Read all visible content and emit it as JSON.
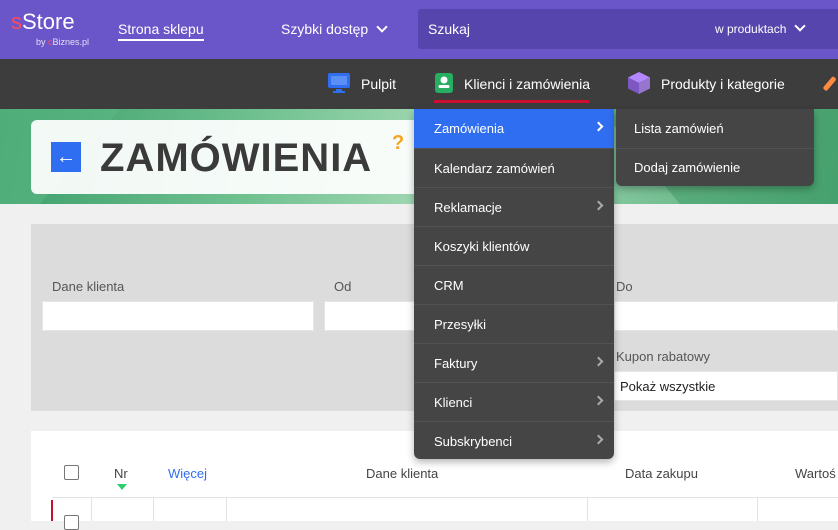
{
  "header": {
    "logo_s": "s",
    "logo_rest": "Store",
    "logo_by": "by ",
    "logo_brand_c": "c",
    "logo_brand_rest": "Biznes.pl",
    "store_link": "Strona sklepu",
    "quick_access": "Szybki dostęp",
    "search_placeholder": "Szukaj",
    "search_scope": "w produktach"
  },
  "nav": {
    "items": [
      {
        "label": "Pulpit",
        "icon": "monitor-icon"
      },
      {
        "label": "Klienci i zamówienia",
        "icon": "contacts-icon",
        "active": true
      },
      {
        "label": "Produkty i kategorie",
        "icon": "box-icon"
      }
    ]
  },
  "page": {
    "title": "ZAMÓWIENIA",
    "help": "?"
  },
  "filters": {
    "client_label": "Dane klienta",
    "from_label": "Od",
    "to_label": "Do",
    "coupon_label": "Kupon rabatowy",
    "coupon_value": "Pokaż wszystkie"
  },
  "table": {
    "headers": [
      "Nr",
      "Więcej",
      "Dane klienta",
      "Data zakupu",
      "Wartoś"
    ]
  },
  "dropdown": {
    "items": [
      {
        "label": "Zamówienia",
        "active": true,
        "submenu": true
      },
      {
        "label": "Kalendarz zamówień",
        "submenu": false
      },
      {
        "label": "Reklamacje",
        "submenu": true
      },
      {
        "label": "Koszyki klientów",
        "submenu": false
      },
      {
        "label": "CRM",
        "submenu": false
      },
      {
        "label": "Przesyłki",
        "submenu": false
      },
      {
        "label": "Faktury",
        "submenu": true
      },
      {
        "label": "Klienci",
        "submenu": true
      },
      {
        "label": "Subskrybenci",
        "submenu": true
      }
    ],
    "submenu_items": [
      "Lista zamówień",
      "Dodaj zamówienie"
    ]
  },
  "colors": {
    "topbar": "#6a56c8",
    "navbar": "#3d3d3d",
    "accent": "#2f6ef0",
    "active_underline": "#c8102e"
  }
}
